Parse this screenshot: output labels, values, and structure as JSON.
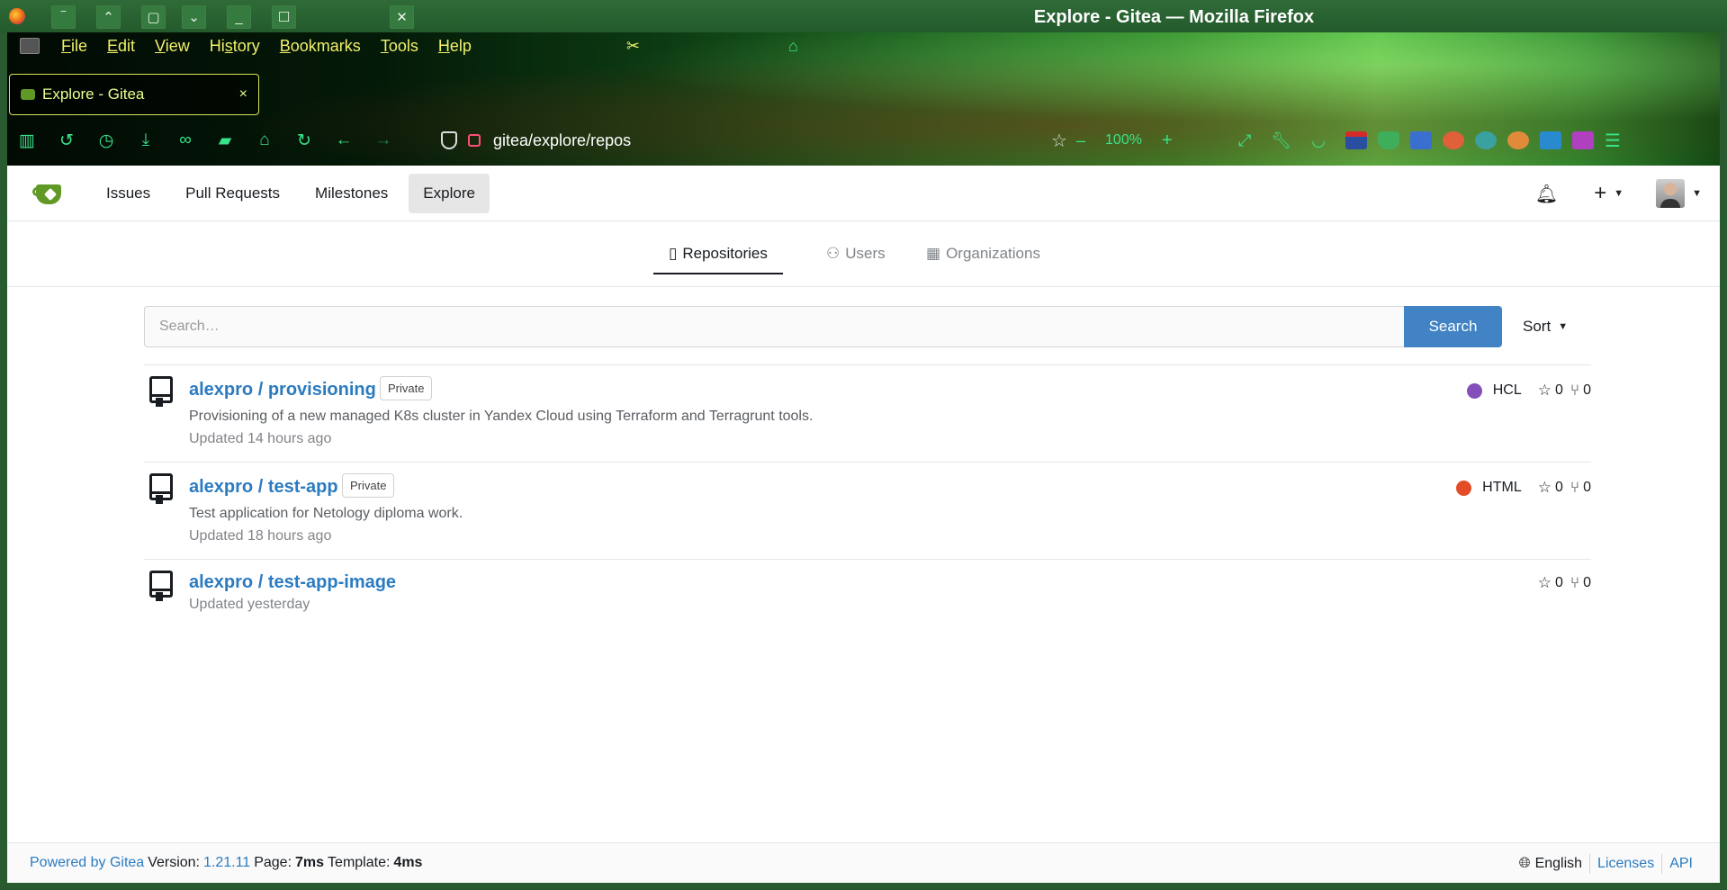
{
  "window": {
    "title": "Explore - Gitea — Mozilla Firefox"
  },
  "menubar": {
    "items": [
      {
        "pre": "",
        "u": "F",
        "post": "ile"
      },
      {
        "pre": "",
        "u": "E",
        "post": "dit"
      },
      {
        "pre": "",
        "u": "V",
        "post": "iew"
      },
      {
        "pre": "Hi",
        "u": "s",
        "post": "tory"
      },
      {
        "pre": "",
        "u": "B",
        "post": "ookmarks"
      },
      {
        "pre": "",
        "u": "T",
        "post": "ools"
      },
      {
        "pre": "",
        "u": "H",
        "post": "elp"
      }
    ]
  },
  "tab": {
    "title": "Explore - Gitea",
    "close": "×"
  },
  "toolbar": {
    "url": "gitea/explore/repos",
    "zoom": "100%",
    "zoom_out": "–",
    "zoom_in": "+"
  },
  "gitea_nav": {
    "items": [
      "Issues",
      "Pull Requests",
      "Milestones",
      "Explore"
    ],
    "active": "Explore"
  },
  "explore_tabs": {
    "repositories": "Repositories",
    "users": "Users",
    "organizations": "Organizations"
  },
  "search": {
    "placeholder": "Search…",
    "button": "Search",
    "sort": "Sort"
  },
  "repos": [
    {
      "name": "alexpro / provisioning",
      "badge": "Private",
      "description": "Provisioning of a new managed K8s cluster in Yandex Cloud using Terraform and Terragrunt tools.",
      "updated": "Updated 14 hours ago",
      "language": "HCL",
      "language_color": "#844fba",
      "stars": "0",
      "forks": "0"
    },
    {
      "name": "alexpro / test-app",
      "badge": "Private",
      "description": "Test application for Netology diploma work.",
      "updated": "Updated 18 hours ago",
      "language": "HTML",
      "language_color": "#e34c26",
      "stars": "0",
      "forks": "0"
    },
    {
      "name": "alexpro / test-app-image",
      "badge": "",
      "description": "",
      "updated": "Updated yesterday",
      "language": "",
      "language_color": "",
      "stars": "0",
      "forks": "0"
    }
  ],
  "footer": {
    "powered_by": "Powered by Gitea",
    "version_label": "Version:",
    "version": "1.21.11",
    "page_label": "Page:",
    "page_time": "7ms",
    "template_label": "Template:",
    "template_time": "4ms",
    "language": "English",
    "licenses": "Licenses",
    "api": "API"
  },
  "colors": {
    "link": "#2b7bc0",
    "search_button": "#4183c4",
    "gitea_green": "#609926",
    "menu_text": "#f2f06a",
    "toolbar_icon": "#39e38a"
  }
}
